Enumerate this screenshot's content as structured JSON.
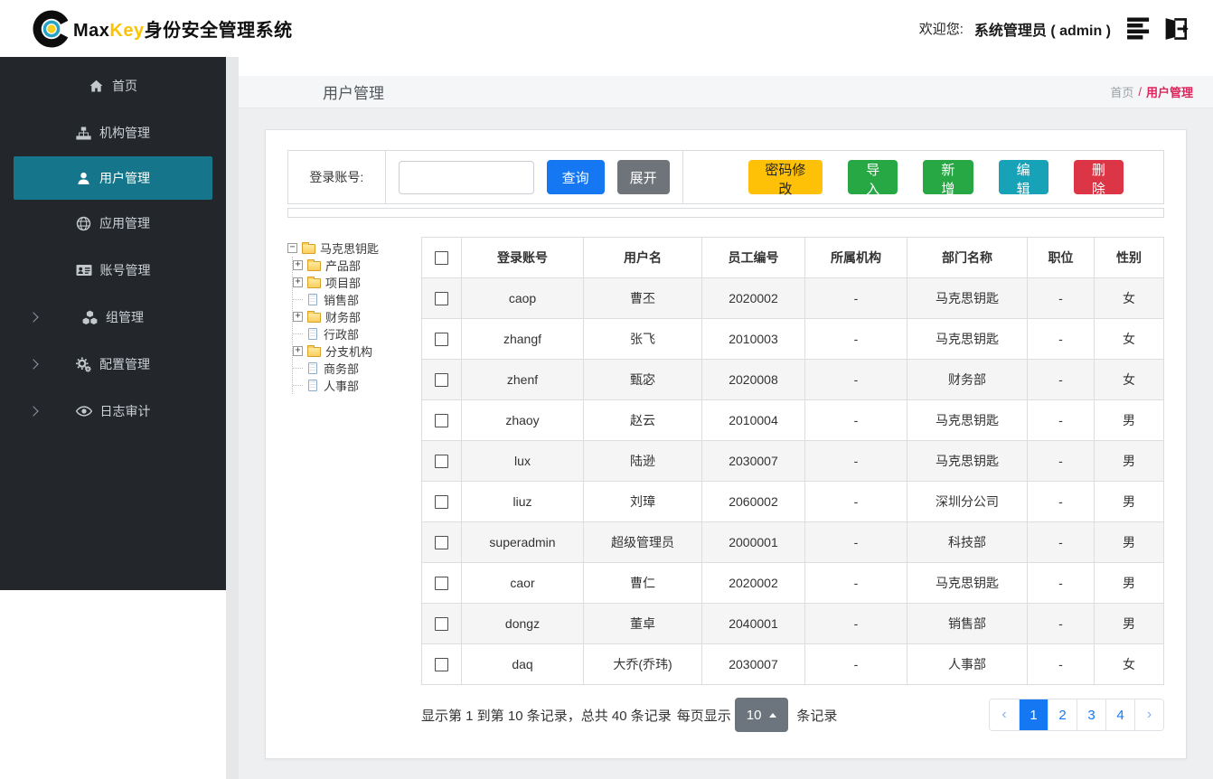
{
  "colors": {
    "sidebar_bg": "#23272c",
    "active_teal": "#15768b",
    "primary_blue": "#1677f2",
    "breadcrumb_pink": "#e0225c"
  },
  "header": {
    "brand_max": "Max",
    "brand_key": "Key",
    "brand_suffix": "身份安全管理系统",
    "welcome_label": "欢迎您:",
    "user_display": "系统管理员 ( admin )"
  },
  "sidebar": {
    "items": [
      {
        "key": "home",
        "label": "首页",
        "icon": "home-icon",
        "active": false,
        "chevron": false
      },
      {
        "key": "org",
        "label": "机构管理",
        "icon": "sitemap-icon",
        "active": false,
        "chevron": false
      },
      {
        "key": "user",
        "label": "用户管理",
        "icon": "user-icon",
        "active": true,
        "chevron": false
      },
      {
        "key": "app",
        "label": "应用管理",
        "icon": "globe-icon",
        "active": false,
        "chevron": false
      },
      {
        "key": "account",
        "label": "账号管理",
        "icon": "id-card-icon",
        "active": false,
        "chevron": false
      },
      {
        "key": "group",
        "label": "组管理",
        "icon": "cubes-icon",
        "active": false,
        "chevron": true
      },
      {
        "key": "config",
        "label": "配置管理",
        "icon": "gears-icon",
        "active": false,
        "chevron": true
      },
      {
        "key": "audit",
        "label": "日志审计",
        "icon": "eye-icon",
        "active": false,
        "chevron": true
      }
    ]
  },
  "page": {
    "title": "用户管理",
    "breadcrumb_home": "首页",
    "breadcrumb_sep": "/",
    "breadcrumb_current": "用户管理"
  },
  "search": {
    "label": "登录账号:",
    "input_value": "",
    "query_label": "查询",
    "expand_label": "展开"
  },
  "actions": [
    {
      "key": "change-password",
      "label": "密码修改",
      "bg": "#ffc107",
      "fg": "#212529"
    },
    {
      "key": "import",
      "label": "导入",
      "bg": "#28a745",
      "fg": "#ffffff"
    },
    {
      "key": "add",
      "label": "新增",
      "bg": "#28a745",
      "fg": "#ffffff"
    },
    {
      "key": "edit",
      "label": "编辑",
      "bg": "#17a2b8",
      "fg": "#ffffff"
    },
    {
      "key": "delete",
      "label": "删除",
      "bg": "#dc3545",
      "fg": "#ffffff"
    }
  ],
  "tree": {
    "root": "马克思钥匙",
    "children": [
      {
        "name": "产品部",
        "type": "folder",
        "expandable": true
      },
      {
        "name": "项目部",
        "type": "folder",
        "expandable": true
      },
      {
        "name": "销售部",
        "type": "file",
        "expandable": false
      },
      {
        "name": "财务部",
        "type": "folder",
        "expandable": true
      },
      {
        "name": "行政部",
        "type": "file",
        "expandable": false
      },
      {
        "name": "分支机构",
        "type": "folder",
        "expandable": true
      },
      {
        "name": "商务部",
        "type": "file",
        "expandable": false
      },
      {
        "name": "人事部",
        "type": "file",
        "expandable": false
      }
    ]
  },
  "table": {
    "columns": [
      "登录账号",
      "用户名",
      "员工编号",
      "所属机构",
      "部门名称",
      "职位",
      "性别"
    ],
    "rows": [
      [
        "caop",
        "曹丕",
        "2020002",
        "-",
        "马克思钥匙",
        "-",
        "女"
      ],
      [
        "zhangf",
        "张飞",
        "2010003",
        "-",
        "马克思钥匙",
        "-",
        "女"
      ],
      [
        "zhenf",
        "甄宓",
        "2020008",
        "-",
        "财务部",
        "-",
        "女"
      ],
      [
        "zhaoy",
        "赵云",
        "2010004",
        "-",
        "马克思钥匙",
        "-",
        "男"
      ],
      [
        "lux",
        "陆逊",
        "2030007",
        "-",
        "马克思钥匙",
        "-",
        "男"
      ],
      [
        "liuz",
        "刘璋",
        "2060002",
        "-",
        "深圳分公司",
        "-",
        "男"
      ],
      [
        "superadmin",
        "超级管理员",
        "2000001",
        "-",
        "科技部",
        "-",
        "男"
      ],
      [
        "caor",
        "曹仁",
        "2020002",
        "-",
        "马克思钥匙",
        "-",
        "男"
      ],
      [
        "dongz",
        "董卓",
        "2040001",
        "-",
        "销售部",
        "-",
        "男"
      ],
      [
        "daq",
        "大乔(乔玮)",
        "2030007",
        "-",
        "人事部",
        "-",
        "女"
      ]
    ]
  },
  "footer": {
    "info_prefix": "显示第 1 到第 10 条记录，总共 40 条记录",
    "per_page_label": "每页显示",
    "page_size": "10",
    "suffix": "条记录",
    "pages": [
      "‹",
      "1",
      "2",
      "3",
      "4",
      "›"
    ],
    "active_page": "1"
  }
}
